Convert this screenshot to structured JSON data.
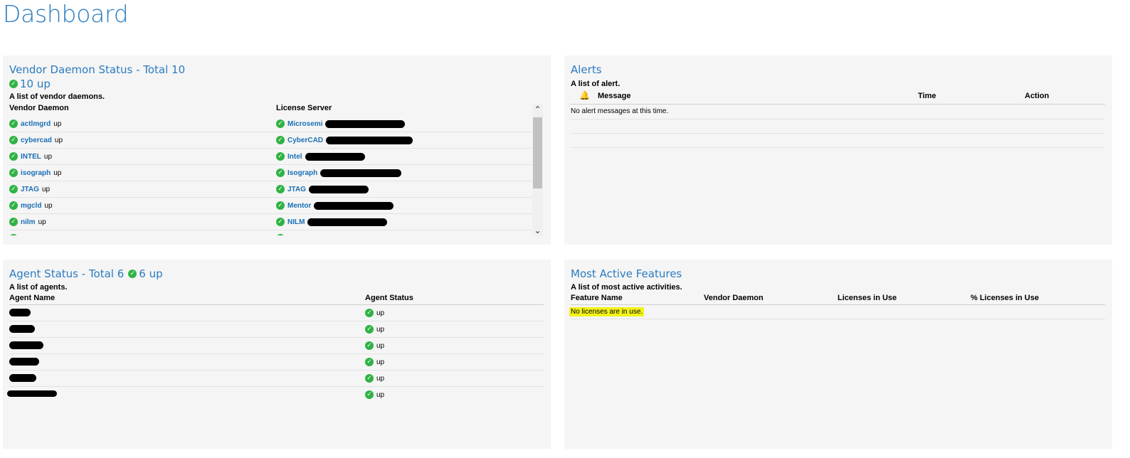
{
  "page": {
    "title": "Dashboard"
  },
  "vendor": {
    "title": "Vendor Daemon Status - Total 10",
    "up_text": "10 up",
    "description": "A list of vendor daemons.",
    "col_daemon": "Vendor Daemon",
    "col_server": "License Server",
    "rows": [
      {
        "daemon": "actlmgrd",
        "status": "up",
        "server": "Microsemi"
      },
      {
        "daemon": "cybercad",
        "status": "up",
        "server": "CyberCAD"
      },
      {
        "daemon": "INTEL",
        "status": "up",
        "server": "Intel"
      },
      {
        "daemon": "isograph",
        "status": "up",
        "server": "Isograph"
      },
      {
        "daemon": "JTAG",
        "status": "up",
        "server": "JTAG"
      },
      {
        "daemon": "mgcld",
        "status": "up",
        "server": "Mentor"
      },
      {
        "daemon": "nilm",
        "status": "up",
        "server": "NILM"
      }
    ],
    "icons": {
      "check": "check-circle-icon",
      "up": "chevron-up-icon",
      "down": "chevron-down-icon"
    }
  },
  "alerts": {
    "title": "Alerts",
    "description": "A list of alert.",
    "col_message": "Message",
    "col_time": "Time",
    "col_action": "Action",
    "empty_text": "No alert messages at this time.",
    "icons": {
      "bell": "bell-icon"
    }
  },
  "agent": {
    "title": "Agent Status - Total 6",
    "up_text": "6 up",
    "description": "A list of agents.",
    "col_name": "Agent Name",
    "col_status": "Agent Status",
    "rows": [
      {
        "status": "up"
      },
      {
        "status": "up"
      },
      {
        "status": "up"
      },
      {
        "status": "up"
      },
      {
        "status": "up"
      },
      {
        "status": "up"
      }
    ]
  },
  "features": {
    "title": "Most Active Features",
    "description": "A list of most active activities.",
    "col_feature": "Feature Name",
    "col_daemon": "Vendor Daemon",
    "col_licenses": "Licenses in Use",
    "col_percent": "% Licenses in Use",
    "empty_text": "No licenses are in use.",
    "highlight_color": "#f3f31a"
  },
  "colors": {
    "accent": "#2b7bc0",
    "link": "#1a6fb5",
    "ok": "#2fb344",
    "panel": "#f5f5f5"
  }
}
